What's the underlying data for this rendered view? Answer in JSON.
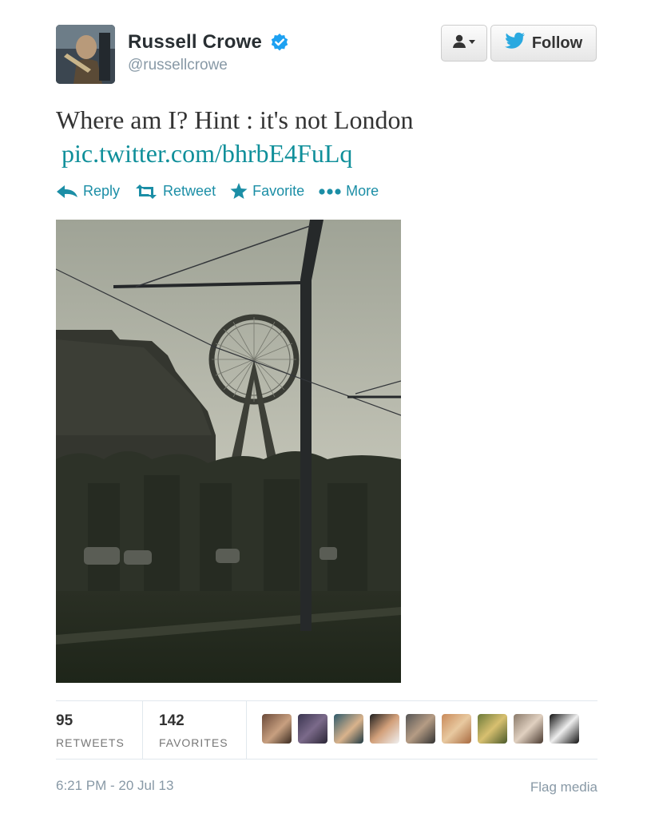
{
  "user": {
    "display_name": "Russell Crowe",
    "screen_name": "@russellcrowe",
    "verified": true
  },
  "buttons": {
    "follow_label": "Follow"
  },
  "tweet": {
    "text": "Where am I?  Hint : it's not London",
    "link": "pic.twitter.com/bhrbE4FuLq"
  },
  "actions": {
    "reply": "Reply",
    "retweet": "Retweet",
    "favorite": "Favorite",
    "more": "More"
  },
  "stats": {
    "retweets_count": "95",
    "retweets_label": "RETWEETS",
    "favorites_count": "142",
    "favorites_label": "FAVORITES"
  },
  "favoriters": [
    {
      "icon": "user-avatar-1"
    },
    {
      "icon": "user-avatar-2"
    },
    {
      "icon": "user-avatar-3"
    },
    {
      "icon": "user-avatar-4"
    },
    {
      "icon": "user-avatar-5"
    },
    {
      "icon": "user-avatar-6"
    },
    {
      "icon": "user-avatar-7"
    },
    {
      "icon": "user-avatar-8"
    },
    {
      "icon": "user-avatar-9"
    }
  ],
  "footer": {
    "timestamp": "6:21 PM - 20 Jul 13",
    "flag_media": "Flag media"
  },
  "colors": {
    "link": "#0f8f9a",
    "action": "#1b8ea6",
    "verified": "#1da1f2",
    "twitter_bird": "#2aa9e0"
  }
}
